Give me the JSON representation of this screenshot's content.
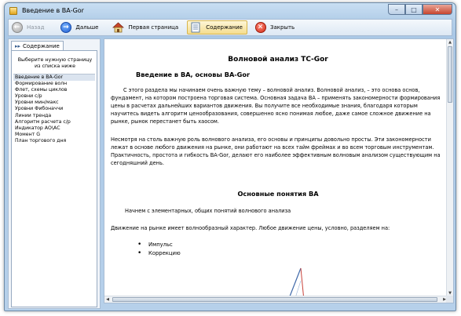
{
  "window": {
    "title": "Введение в ВА-Gor"
  },
  "title_buttons": {
    "min": "–",
    "max": "□",
    "close": "✕"
  },
  "toolbar": [
    {
      "id": "back",
      "label": "Назад",
      "icon": "back-arrow-icon",
      "disabled": true
    },
    {
      "id": "forward",
      "label": "Дальше",
      "icon": "forward-arrow-icon",
      "disabled": false
    },
    {
      "id": "home",
      "label": "Первая страница",
      "icon": "home-icon",
      "disabled": false
    },
    {
      "id": "contents",
      "label": "Содержание",
      "icon": "contents-icon",
      "disabled": false,
      "active": true
    },
    {
      "id": "close",
      "label": "Закрыть",
      "icon": "close-icon",
      "disabled": false
    }
  ],
  "sidebar": {
    "tab_label": "Содержание",
    "hint": "Выберите нужную страницу из списка ниже",
    "items": [
      "Введение в ВА-Gor",
      "Формирование волн",
      "Флет, схемы циклов",
      "Уровни с/р",
      "Уровни мин/макс",
      "Уровни Фибоначчи",
      "Линии тренда",
      "Алгоритм расчета с/р",
      "Индикатор АО\\АС",
      "Момент G",
      "План торгового дня"
    ],
    "selected_index": 0
  },
  "content": {
    "title": "Волновой анализ ТС-Gor",
    "section1_heading": "Введение в ВА, основы ВА-Gor",
    "para1": "С этого раздела мы начинаем очень важную тему – волновой анализ. Волновой анализ, – это основа основ, фундамент, на котором построена торговая система. Основная задача ВА – применять закономерности формирования цены в расчетах дальнейших вариантов движения. Вы получите все необходимые знания, благодаря которым научитесь видеть алгоритм ценообразования, совершенно ясно понимая любое, даже самое сложное движение на рынке, рынок перестанет быть хаосом.",
    "para2": "Несмотря на столь важную роль волнового анализа, его основы и принципы довольно просты. Эти закономерности лежат в основе любого движения на рынке, они работают на всех тайм фреймах и во всем торговым инструментам. Практичность, простота и гибкость ВА-Gor, делают его наиболее эффективным волновым анализом существующим на сегодняшний день.",
    "section2_heading": "Основные понятия ВА",
    "para3": "Начнем с элементарных, общих понятий волнового анализа",
    "para4": "Движение на рынке имеет волнообразный характер. Любое движение цены, условно, разделяем на:",
    "bullets": [
      "Импульс",
      "Коррекцию"
    ]
  }
}
